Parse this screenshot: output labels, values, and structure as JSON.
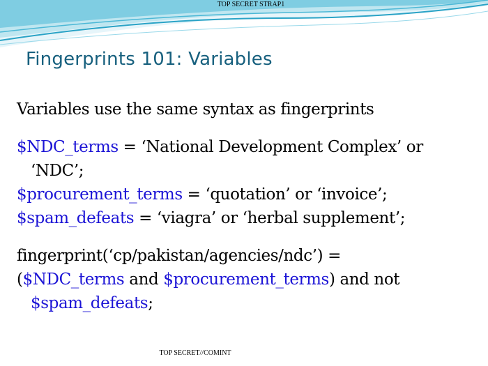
{
  "classification_top": "TOP SECRET STRAP1",
  "classification_bottom": "TOP SECRET//COMINT",
  "title": "Fingerprints 101: Variables",
  "intro": "Variables use the same syntax as fingerprints",
  "definitions": [
    {
      "name": "$NDC_terms",
      "value_line1": " = ‘National Development Complex’ or",
      "value_line2": "‘NDC’;"
    },
    {
      "name": "$procurement_terms",
      "value": " = ‘quotation’ or ‘invoice’;"
    },
    {
      "name": "$spam_defeats",
      "value": " = ‘viagra’ or ‘herbal supplement’;"
    }
  ],
  "fingerprint": {
    "line1": "fingerprint(‘cp/pakistan/agencies/ndc’) =",
    "open_paren": "(",
    "var1": "$NDC_terms",
    "and_text": " and ",
    "var2": "$procurement_terms",
    "close_text": ") and not",
    "var3": "$spam_defeats",
    "end": ";"
  },
  "colors": {
    "title": "#17607e",
    "variable": "#1c14d6",
    "wave_dark": "#2aa3c6",
    "wave_light": "#bfe6f0"
  }
}
